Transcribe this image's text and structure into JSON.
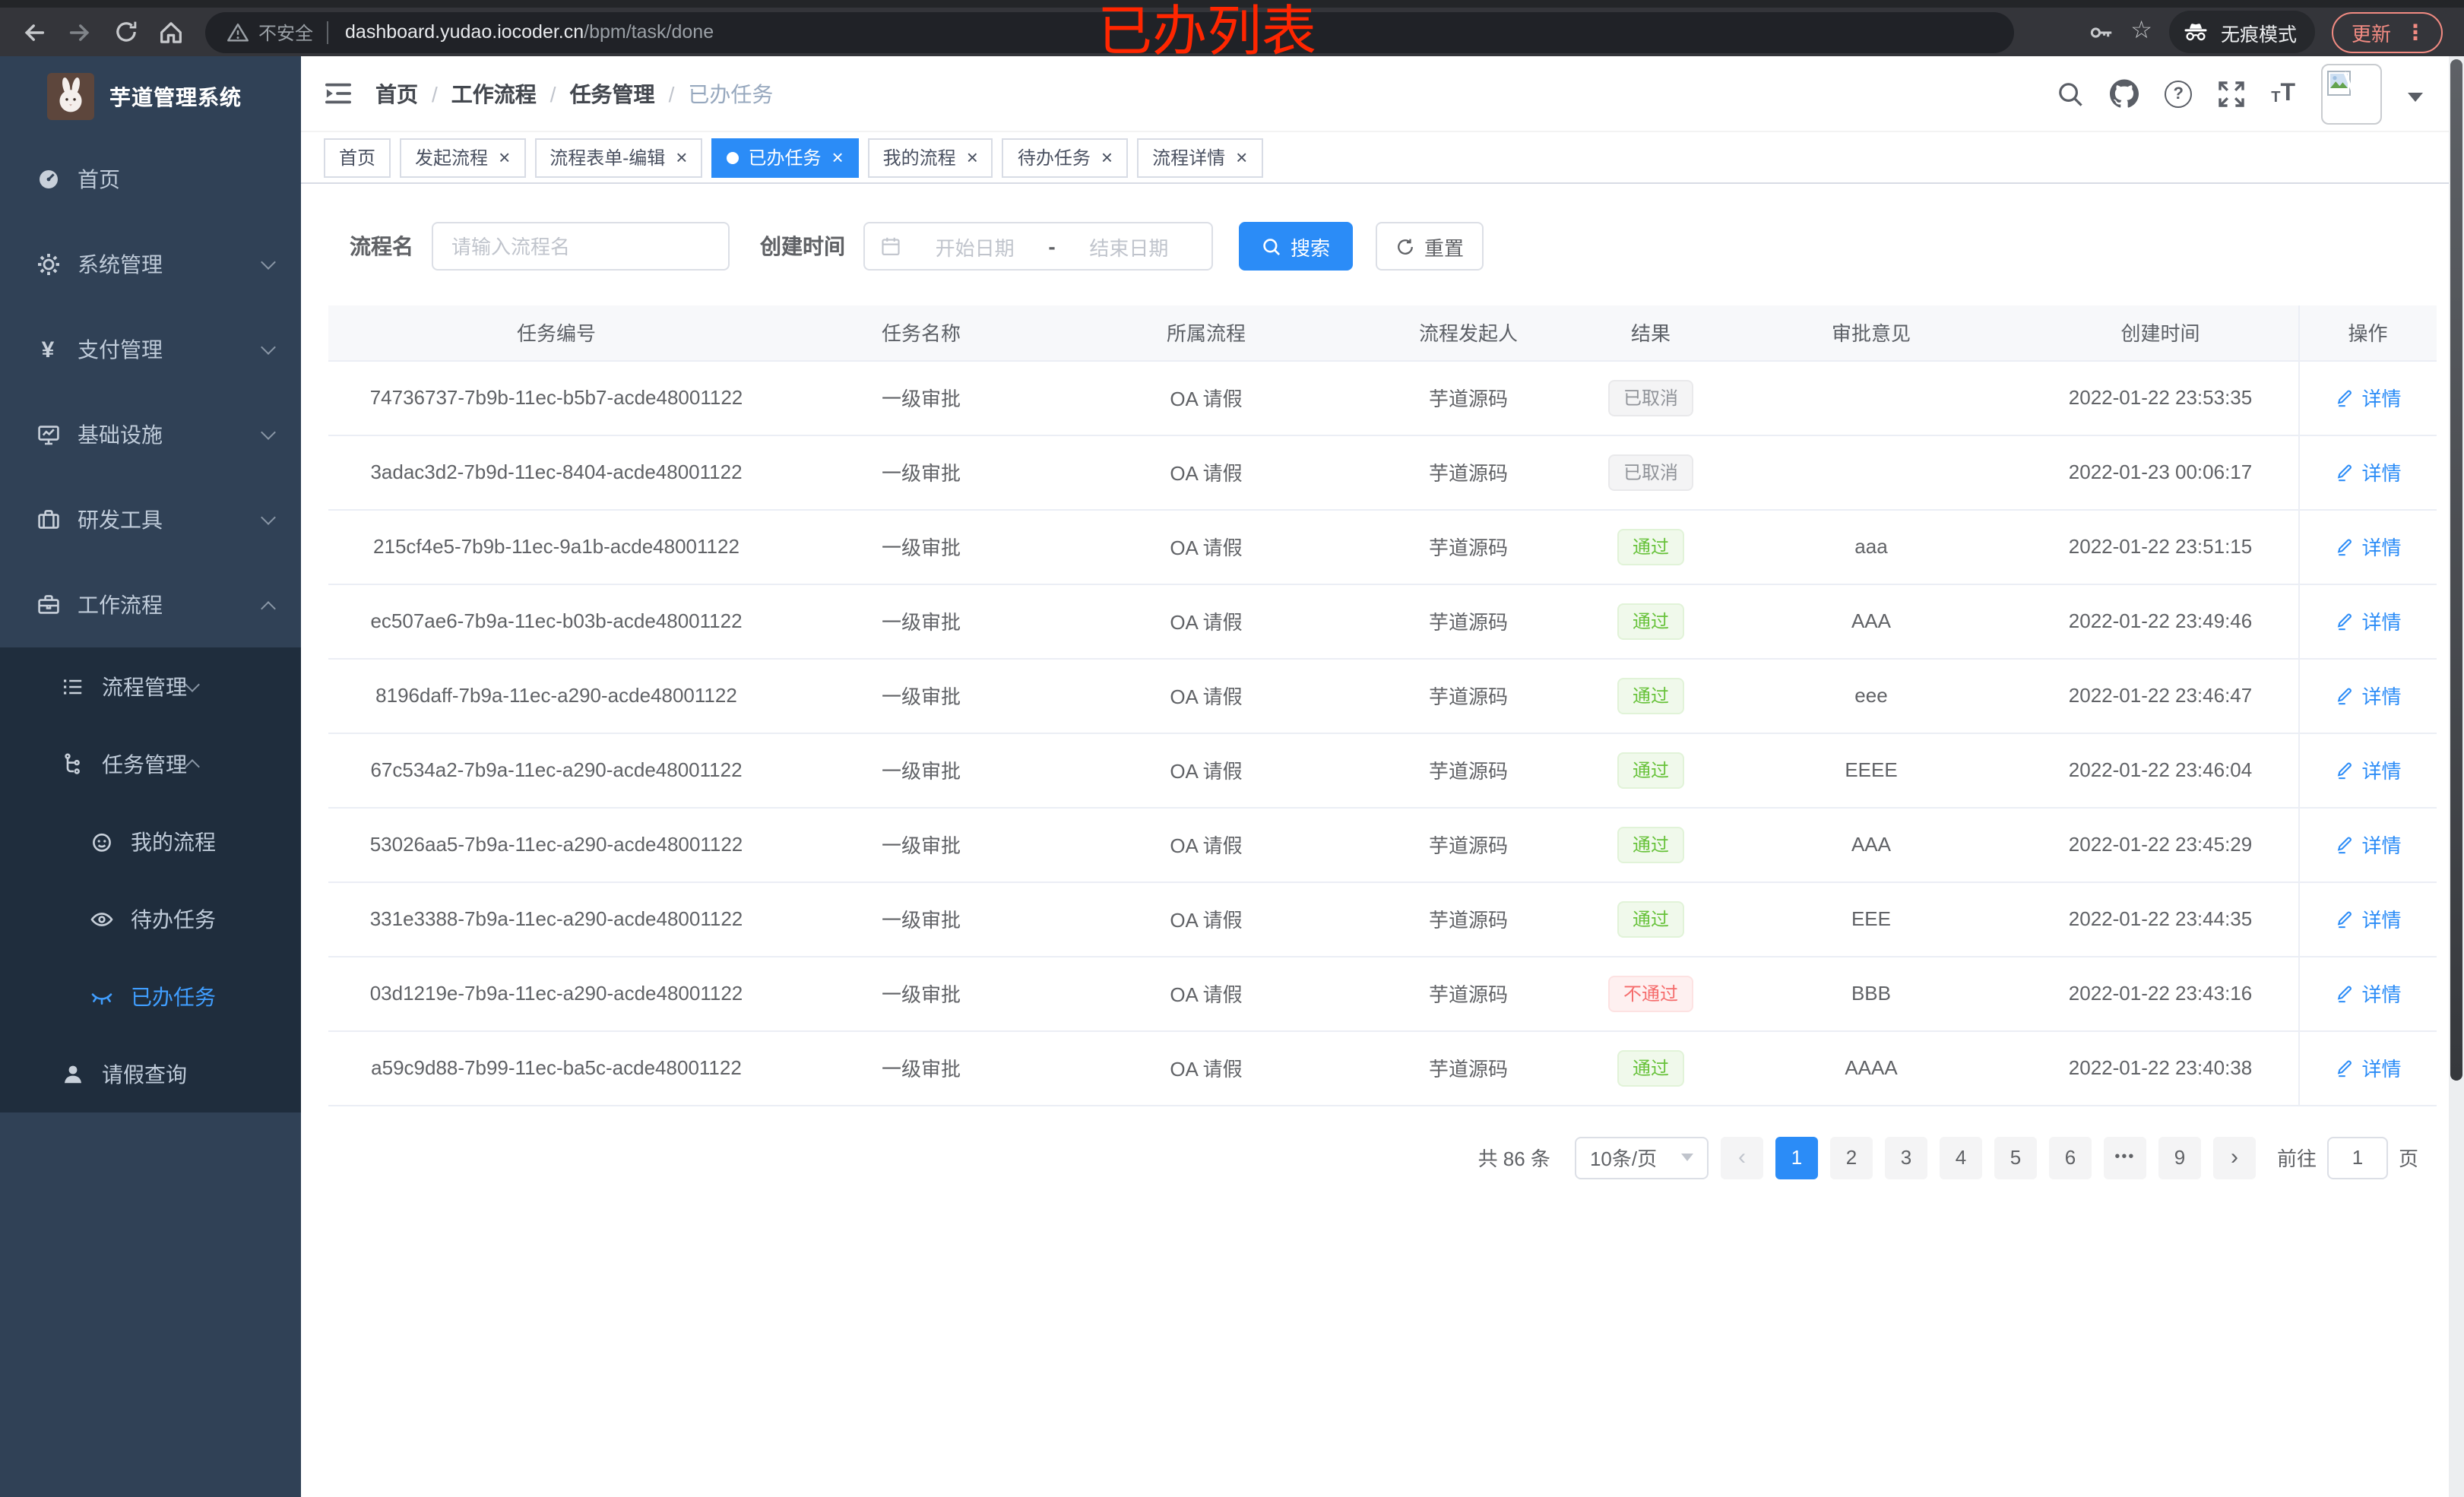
{
  "annotation": {
    "text": "已办列表",
    "color": "#ff2600"
  },
  "chrome": {
    "security_label": "不安全",
    "url_domain": "dashboard.yudao.iocoder.cn",
    "url_path": "/bpm/task/done",
    "incognito_label": "无痕模式",
    "update_label": "更新"
  },
  "glyphs": {
    "close": "×",
    "slash": "/",
    "star": "☆",
    "kebab": "⋮",
    "prev": "‹",
    "next": "›",
    "question": "?",
    "letter_t": "T"
  },
  "sidebar": {
    "title": "芋道管理系统",
    "items": [
      {
        "label": "首页",
        "icon": "dashboard-icon"
      },
      {
        "label": "系统管理",
        "icon": "gear-icon"
      },
      {
        "label": "支付管理",
        "icon": "yen-icon"
      },
      {
        "label": "基础设施",
        "icon": "monitor-icon"
      },
      {
        "label": "研发工具",
        "icon": "toolbox-icon"
      },
      {
        "label": "工作流程",
        "icon": "briefcase-icon"
      }
    ],
    "submenu": {
      "items": [
        {
          "label": "流程管理",
          "icon": "list-icon"
        },
        {
          "label": "任务管理",
          "icon": "tree-icon"
        }
      ],
      "children": [
        {
          "label": "我的流程",
          "icon": "robot-icon"
        },
        {
          "label": "待办任务",
          "icon": "eye-open-icon"
        },
        {
          "label": "已办任务",
          "icon": "eye-closed-icon",
          "active": true
        }
      ],
      "leave_query": {
        "label": "请假查询",
        "icon": "person-icon"
      }
    }
  },
  "breadcrumb": [
    "首页",
    "工作流程",
    "任务管理",
    "已办任务"
  ],
  "tabs": [
    {
      "label": "首页",
      "closable": false,
      "active": false
    },
    {
      "label": "发起流程",
      "closable": true,
      "active": false
    },
    {
      "label": "流程表单-编辑",
      "closable": true,
      "active": false
    },
    {
      "label": "已办任务",
      "closable": true,
      "active": true
    },
    {
      "label": "我的流程",
      "closable": true,
      "active": false
    },
    {
      "label": "待办任务",
      "closable": true,
      "active": false
    },
    {
      "label": "流程详情",
      "closable": true,
      "active": false
    }
  ],
  "filter": {
    "name_label": "流程名",
    "name_placeholder": "请输入流程名",
    "time_label": "创建时间",
    "start_placeholder": "开始日期",
    "range_separator": "-",
    "end_placeholder": "结束日期",
    "search_label": "搜索",
    "reset_label": "重置"
  },
  "table": {
    "headers": [
      "任务编号",
      "任务名称",
      "所属流程",
      "流程发起人",
      "结果",
      "审批意见",
      "创建时间",
      "操作"
    ],
    "action_label": "详情",
    "rows": [
      {
        "id": "74736737-7b9b-11ec-b5b7-acde48001122",
        "name": "一级审批",
        "process": "OA 请假",
        "initiator": "芋道源码",
        "result": "已取消",
        "result_type": "cancel",
        "comment": "",
        "time": "2022-01-22 23:53:35"
      },
      {
        "id": "3adac3d2-7b9d-11ec-8404-acde48001122",
        "name": "一级审批",
        "process": "OA 请假",
        "initiator": "芋道源码",
        "result": "已取消",
        "result_type": "cancel",
        "comment": "",
        "time": "2022-01-23 00:06:17"
      },
      {
        "id": "215cf4e5-7b9b-11ec-9a1b-acde48001122",
        "name": "一级审批",
        "process": "OA 请假",
        "initiator": "芋道源码",
        "result": "通过",
        "result_type": "pass",
        "comment": "aaa",
        "time": "2022-01-22 23:51:15"
      },
      {
        "id": "ec507ae6-7b9a-11ec-b03b-acde48001122",
        "name": "一级审批",
        "process": "OA 请假",
        "initiator": "芋道源码",
        "result": "通过",
        "result_type": "pass",
        "comment": "AAA",
        "time": "2022-01-22 23:49:46"
      },
      {
        "id": "8196daff-7b9a-11ec-a290-acde48001122",
        "name": "一级审批",
        "process": "OA 请假",
        "initiator": "芋道源码",
        "result": "通过",
        "result_type": "pass",
        "comment": "eee",
        "time": "2022-01-22 23:46:47"
      },
      {
        "id": "67c534a2-7b9a-11ec-a290-acde48001122",
        "name": "一级审批",
        "process": "OA 请假",
        "initiator": "芋道源码",
        "result": "通过",
        "result_type": "pass",
        "comment": "EEEE",
        "time": "2022-01-22 23:46:04"
      },
      {
        "id": "53026aa5-7b9a-11ec-a290-acde48001122",
        "name": "一级审批",
        "process": "OA 请假",
        "initiator": "芋道源码",
        "result": "通过",
        "result_type": "pass",
        "comment": "AAA",
        "time": "2022-01-22 23:45:29"
      },
      {
        "id": "331e3388-7b9a-11ec-a290-acde48001122",
        "name": "一级审批",
        "process": "OA 请假",
        "initiator": "芋道源码",
        "result": "通过",
        "result_type": "pass",
        "comment": "EEE",
        "time": "2022-01-22 23:44:35"
      },
      {
        "id": "03d1219e-7b9a-11ec-a290-acde48001122",
        "name": "一级审批",
        "process": "OA 请假",
        "initiator": "芋道源码",
        "result": "不通过",
        "result_type": "fail",
        "comment": "BBB",
        "time": "2022-01-22 23:43:16"
      },
      {
        "id": "a59c9d88-7b99-11ec-ba5c-acde48001122",
        "name": "一级审批",
        "process": "OA 请假",
        "initiator": "芋道源码",
        "result": "通过",
        "result_type": "pass",
        "comment": "AAAA",
        "time": "2022-01-22 23:40:38"
      }
    ]
  },
  "pagination": {
    "total": "共 86 条",
    "page_size": "10条/页",
    "pages": [
      "1",
      "2",
      "3",
      "4",
      "5",
      "6",
      "•••",
      "9"
    ],
    "active_page": "1",
    "goto_label": "前往",
    "goto_value": "1",
    "unit": "页"
  },
  "colors": {
    "accent": "#2b8cf7",
    "success": "#67c23a",
    "danger": "#f56c6c",
    "info": "#909399",
    "sidebar_bg": "#304156",
    "submenu_bg": "#1f2d3d",
    "annotation_red": "#ff2600"
  }
}
